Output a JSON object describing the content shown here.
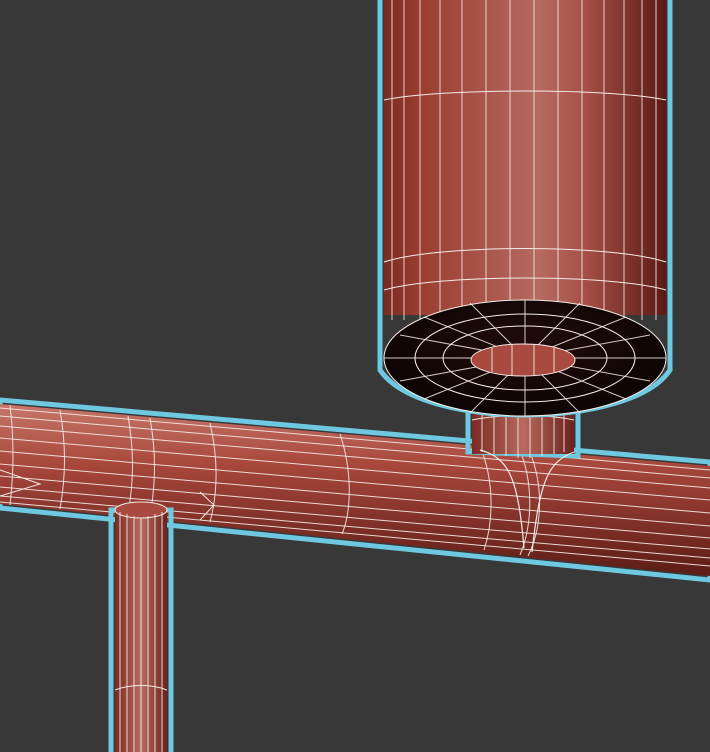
{
  "viewport": {
    "background": "#383838",
    "mode": "wireframe-on-shaded",
    "selection_outline_color": "#6ec8e0",
    "wire_color": "#f4ece6"
  },
  "scene": {
    "objects": [
      {
        "name": "vertical-tank",
        "type": "cylinder",
        "material_color": "#a84a40",
        "selected": true
      },
      {
        "name": "tank-bottom-cap",
        "type": "disc",
        "material_color": "#1a0a08",
        "selected": true
      },
      {
        "name": "tank-outlet-pipe",
        "type": "cylinder",
        "material_color": "#a84a40",
        "selected": true
      },
      {
        "name": "horizontal-pipe",
        "type": "cylinder",
        "material_color": "#a84a40",
        "selected": true
      },
      {
        "name": "lower-vertical-pipe",
        "type": "cylinder",
        "material_color": "#a84a40",
        "selected": true
      }
    ]
  }
}
